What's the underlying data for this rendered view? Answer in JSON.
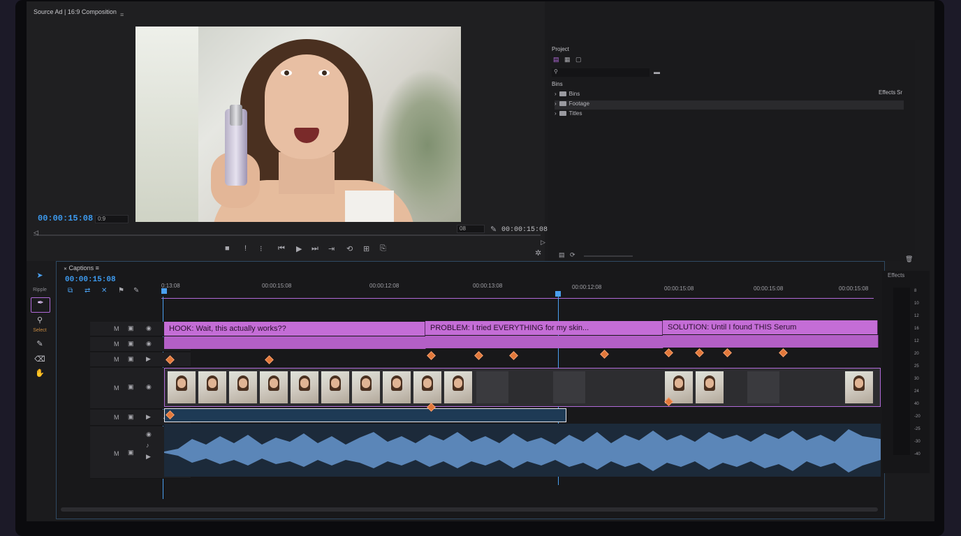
{
  "source_monitor": {
    "title": "Source Ad | 16:9 Composition",
    "menu_glyph": "≡",
    "timecode_in": "00:00:15:08",
    "zoom_select": "0:9",
    "fit_select": "08",
    "timecode_out": "00:00:15:08"
  },
  "transport": {
    "stop": "■",
    "mark_in": "!",
    "mark_out": "⁝",
    "step_back": "⏮",
    "play": "▶",
    "step_forward": "⏭",
    "go_out": "⇥",
    "loop": "⟲",
    "insert": "⊞",
    "export_frame": "⎘",
    "settings": "✲"
  },
  "project_panel": {
    "title": "Project",
    "column_header": "Bins",
    "right_header_1": "Effects",
    "right_header_2": "Sr",
    "items": [
      {
        "label": "Bins"
      },
      {
        "label": "Footage"
      },
      {
        "label": "Titles"
      }
    ]
  },
  "timeline": {
    "sequence_name": "Captions",
    "menu_glyph": "≡",
    "timecode": "00:00:15:08",
    "ruler": [
      "0:13:08",
      "00:00:15:08",
      "00:00:12:08",
      "00:00:13:08",
      "00:00:12:08",
      "00:00:15:08",
      "00:00:15:08",
      "00:00:15:08"
    ],
    "captions": [
      {
        "text": "HOOK: Wait, this actually works??"
      },
      {
        "text": "PROBLEM: I tried EVERYTHING for my skin..."
      },
      {
        "text": "SOLUTION: Until I found THIS Serum"
      }
    ],
    "track_letters": [
      "M",
      "M",
      "M",
      "M",
      "M",
      "M"
    ]
  },
  "tools": {
    "select": "Select",
    "ripple": "Ripple"
  },
  "effects_meter": {
    "label": "Effects",
    "scale": [
      "8",
      "10",
      "12",
      "16",
      "12",
      "20",
      "25",
      "30",
      "24",
      "40",
      "-20",
      "-25",
      "-30",
      "-40"
    ]
  },
  "colors": {
    "accent": "#3d9bf0",
    "caption_clip": "#c46dd6",
    "keyframe": "#e2783a",
    "selection": "#b06ad8"
  }
}
